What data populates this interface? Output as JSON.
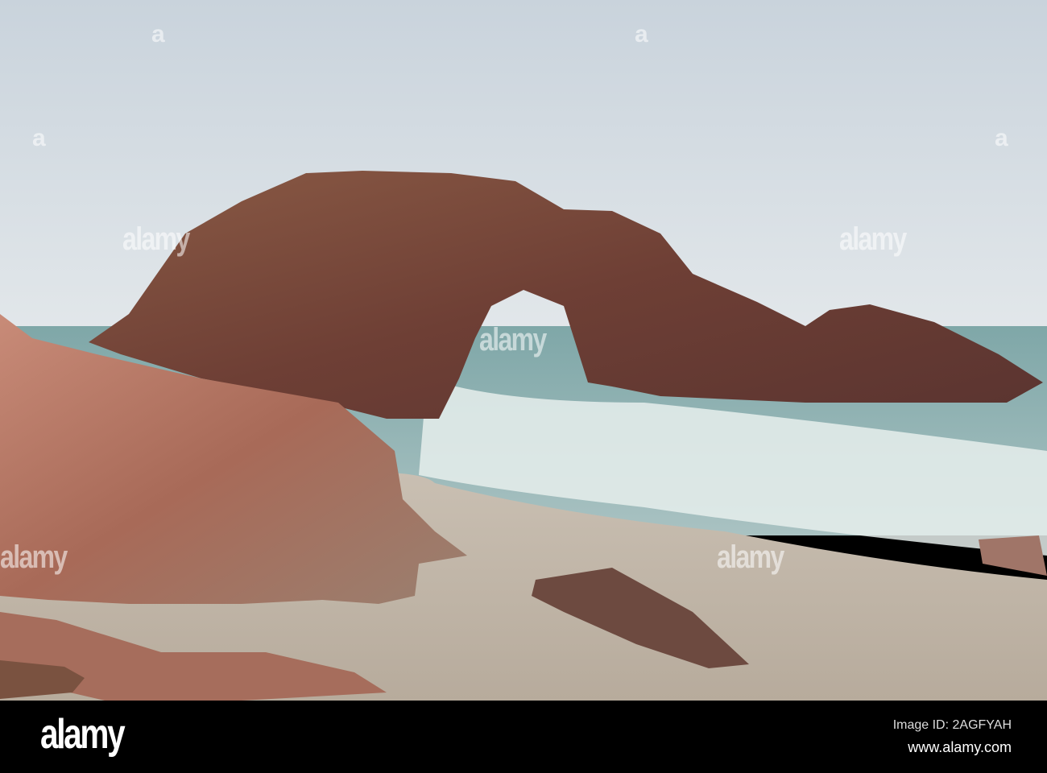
{
  "watermark": {
    "logo": "alamy",
    "mark": "a"
  },
  "footer": {
    "logo": "alamy",
    "image_id": "Image ID: 2AGFYAH",
    "url": "www.alamy.com"
  }
}
